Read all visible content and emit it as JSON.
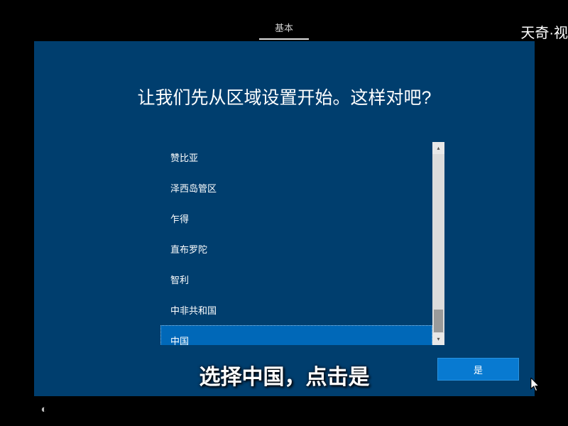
{
  "tab": {
    "label": "基本"
  },
  "watermark": "天奇·视",
  "oobe": {
    "heading": "让我们先从区域设置开始。这样对吧?",
    "regions": [
      {
        "label": "赞比亚",
        "selected": false
      },
      {
        "label": "泽西岛管区",
        "selected": false
      },
      {
        "label": "乍得",
        "selected": false
      },
      {
        "label": "直布罗陀",
        "selected": false
      },
      {
        "label": "智利",
        "selected": false
      },
      {
        "label": "中非共和国",
        "selected": false
      },
      {
        "label": "中国",
        "selected": true
      }
    ],
    "confirm_label": "是"
  },
  "subtitle": "选择中国，点击是",
  "icons": {
    "ease_of_access": "◐",
    "scroll_up": "▴",
    "scroll_down": "▾"
  }
}
